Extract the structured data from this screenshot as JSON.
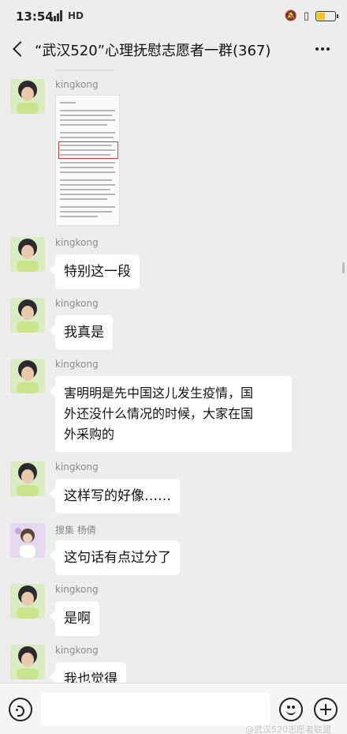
{
  "status_bar": {
    "time": "13:54",
    "network": "HD",
    "battery_level": 0.45,
    "battery_color": "#f3c623"
  },
  "header": {
    "title": "“武汉520”心理抚慰志愿者一群(367)"
  },
  "messages": [
    {
      "sender": "kingkong",
      "type": "image",
      "image_icon": "document-screenshot"
    },
    {
      "sender": "kingkong",
      "type": "text",
      "text": "特别这一段"
    },
    {
      "sender": "kingkong",
      "type": "text",
      "text": "我真是"
    },
    {
      "sender": "kingkong",
      "type": "text",
      "text_lines": [
        "害明明是先中国这儿发生疫情，国",
        "外还没什么情况的时候，大家在国",
        "外采购的"
      ]
    },
    {
      "sender": "kingkong",
      "type": "text",
      "text": "这样写的好像……"
    },
    {
      "sender": "搜集 杨倩",
      "type": "text",
      "text": "这句话有点过分了"
    },
    {
      "sender": "kingkong",
      "type": "text",
      "text": "是啊"
    },
    {
      "sender": "kingkong",
      "type": "text",
      "text": "我也觉得"
    }
  ],
  "input_bar": {
    "placeholder": "",
    "voice_icon": "voice-icon",
    "emoji_icon": "emoji-icon",
    "plus_icon": "plus-icon"
  },
  "watermark": "@武汉520志愿者联盟",
  "colors": {
    "background": "#ededed",
    "bubble": "#ffffff",
    "accent_red": "#d23a3a"
  }
}
